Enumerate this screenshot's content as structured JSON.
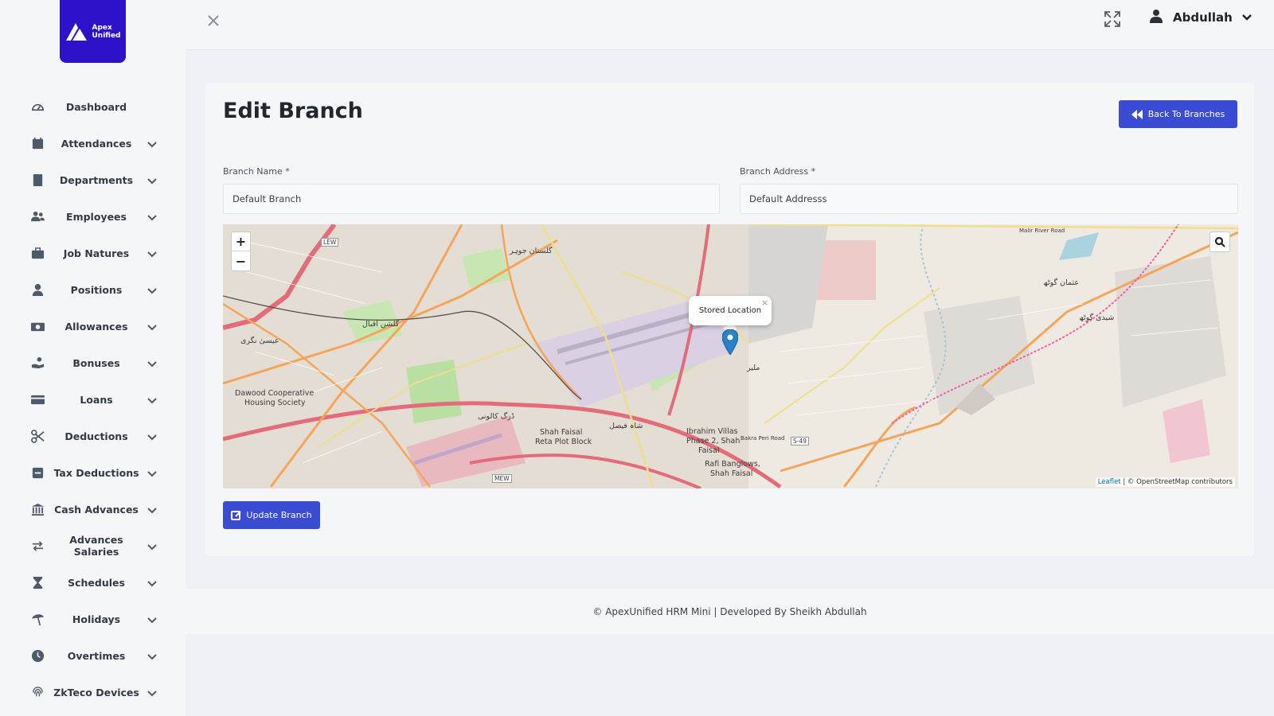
{
  "app": {
    "logo_text_line1": "Apex",
    "logo_text_line2": "Unified"
  },
  "sidebar": {
    "items": [
      {
        "label": "Dashboard",
        "icon": "dashboard-icon",
        "has_submenu": false
      },
      {
        "label": "Attendances",
        "icon": "calendar-icon",
        "has_submenu": true
      },
      {
        "label": "Departments",
        "icon": "building-icon",
        "has_submenu": true
      },
      {
        "label": "Employees",
        "icon": "users-icon",
        "has_submenu": true
      },
      {
        "label": "Job Natures",
        "icon": "briefcase-icon",
        "has_submenu": true
      },
      {
        "label": "Positions",
        "icon": "user-tie-icon",
        "has_submenu": true
      },
      {
        "label": "Allowances",
        "icon": "money-bill-icon",
        "has_submenu": true
      },
      {
        "label": "Bonuses",
        "icon": "hand-coins-icon",
        "has_submenu": true
      },
      {
        "label": "Loans",
        "icon": "credit-card-icon",
        "has_submenu": true
      },
      {
        "label": "Deductions",
        "icon": "scissors-icon",
        "has_submenu": true
      },
      {
        "label": "Tax Deductions",
        "icon": "minus-square-icon",
        "has_submenu": true
      },
      {
        "label": "Cash Advances",
        "icon": "bank-icon",
        "has_submenu": true
      },
      {
        "label": "Advances Salaries",
        "icon": "exchange-icon",
        "has_submenu": true
      },
      {
        "label": "Schedules",
        "icon": "hourglass-icon",
        "has_submenu": true
      },
      {
        "label": "Holidays",
        "icon": "umbrella-beach-icon",
        "has_submenu": true
      },
      {
        "label": "Overtimes",
        "icon": "clock-icon",
        "has_submenu": true
      },
      {
        "label": "ZkTeco Devices",
        "icon": "fingerprint-icon",
        "has_submenu": true
      }
    ]
  },
  "topbar": {
    "user_name": "Abdullah"
  },
  "page": {
    "title": "Edit Branch",
    "back_button": "Back To Branches",
    "branch_name_label": "Branch Name *",
    "branch_name_value": "Default Branch",
    "branch_address_label": "Branch Address *",
    "branch_address_value": "Default Addresss",
    "update_button": "Update Branch"
  },
  "map": {
    "zoom_in": "+",
    "zoom_out": "−",
    "popup_text": "Stored Location",
    "popup_close": "×",
    "attribution_link": "Leaflet",
    "attribution_text": " | © OpenStreetMap contributors",
    "labels": [
      {
        "text": "Dawood Cooperative"
      },
      {
        "text": "Housing Society"
      },
      {
        "text": "Shah Faisal"
      },
      {
        "text": "Reta Plot Block"
      },
      {
        "text": "Ibrahim Villas"
      },
      {
        "text": "Phase 2, Shah"
      },
      {
        "text": "Faisal"
      },
      {
        "text": "Rafi Banglows,"
      },
      {
        "text": "Shah Faisal"
      },
      {
        "text": "S-49"
      },
      {
        "text": "LEW"
      },
      {
        "text": "MEW"
      },
      {
        "text": "Malir River Road"
      },
      {
        "text": "Bakra Peri Road"
      },
      {
        "text": "ملیر"
      },
      {
        "text": "شاہ فیصل"
      },
      {
        "text": "ڈرگ کالونی"
      },
      {
        "text": "گلشن اقبال"
      },
      {
        "text": "عیسیٰ نگری"
      },
      {
        "text": "گلستان جوہر"
      },
      {
        "text": "عثمان گوٹھ"
      },
      {
        "text": "شیدی گوٹھ"
      }
    ],
    "colors": {
      "motorway": "#e36b7a",
      "primary": "#f5a55b",
      "secondary": "#f1de8c",
      "park": "#b9dfa3",
      "airport": "#d9d0e4",
      "water": "#aad3df",
      "rail": "#ee5fa6",
      "marker": "#2a81cb"
    }
  },
  "footer": {
    "text": "© ApexUnified HRM Mini | Developed By Sheikh Abdullah"
  },
  "theme": {
    "accent": "#3a4bd4",
    "logo_bg": "#2c12c9"
  }
}
